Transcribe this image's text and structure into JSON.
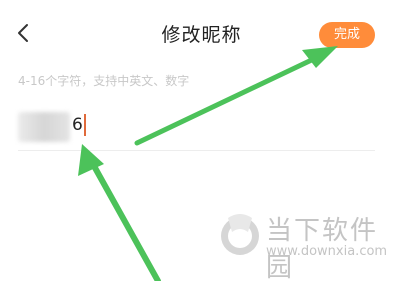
{
  "header": {
    "back_icon": "chevron-left-icon",
    "title": "修改昵称",
    "done_label": "完成"
  },
  "form": {
    "hint": "4-16个字符，支持中英文、数字",
    "nickname_visible_suffix": "6"
  },
  "annotations": {
    "arrow_color": "#4cc25a",
    "done_color": "#ff8c3a",
    "cursor_color": "#e06a3b"
  },
  "watermark": {
    "title": "当下软件园",
    "url": "www.downxia.com"
  }
}
